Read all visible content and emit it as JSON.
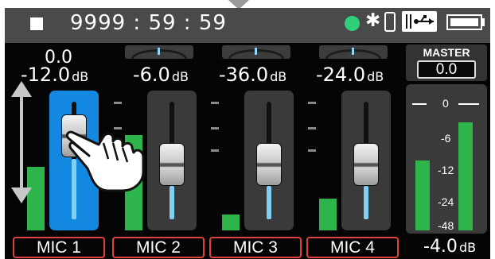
{
  "status": {
    "counter": "9999 : 59 : 59",
    "icons": [
      "stop-icon",
      "recording-indicator-icon",
      "bluetooth-icon",
      "phone-icon",
      "usb-icon",
      "battery-icon"
    ],
    "rec_color": "#2fd07a",
    "bluetooth_glyph": "✱",
    "usb_glyph": "⇹⟶"
  },
  "channels": [
    {
      "label": "MIC 1",
      "gain": "-12.0",
      "unit": "dB",
      "selected": true,
      "pan_value": "0.0",
      "fader_level": 0.72,
      "meter_level": 0.42
    },
    {
      "label": "MIC 2",
      "gain": "-6.0",
      "unit": "dB",
      "selected": false,
      "fader_level": 0.52,
      "meter_level": 0.62
    },
    {
      "label": "MIC 3",
      "gain": "-36.0",
      "unit": "dB",
      "selected": false,
      "fader_level": 0.52,
      "meter_level": 0.1
    },
    {
      "label": "MIC 4",
      "gain": "-24.0",
      "unit": "dB",
      "selected": false,
      "fader_level": 0.52,
      "meter_level": 0.22
    }
  ],
  "master": {
    "label": "MASTER",
    "value": "0.0",
    "level": "-4.0",
    "unit": "dB",
    "scale": [
      "0",
      "-6",
      "-12",
      "-24",
      "-48"
    ],
    "meter_left": 0.45,
    "meter_right": 0.72
  },
  "colors": {
    "accent": "#1388e0",
    "meter": "#2db44a",
    "label_border": "#e0413b",
    "fader_fill": "#7fd0f4"
  }
}
